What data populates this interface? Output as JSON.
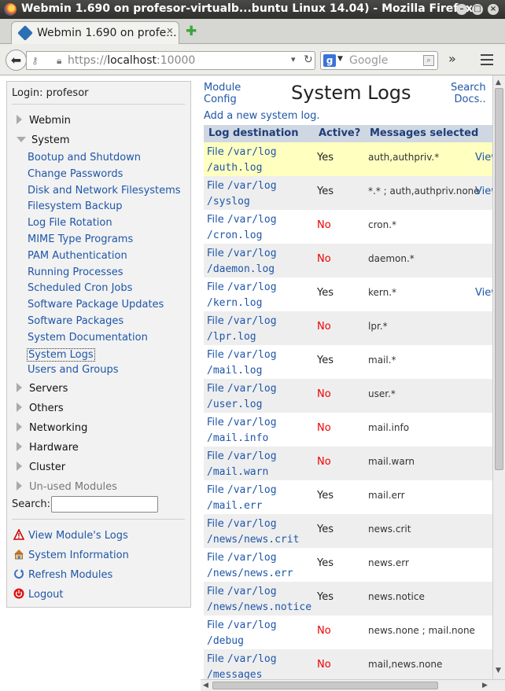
{
  "window": {
    "title": "Webmin 1.690 on profesor-virtualb...buntu Linux 14.04) - Mozilla Firefox"
  },
  "tab": {
    "label": "Webmin 1.690 on profe..."
  },
  "nav": {
    "url_prefix": "https://",
    "url_host": "localhost",
    "url_port": ":10000",
    "search_placeholder": "Google"
  },
  "left": {
    "login": "Login: profesor",
    "categories": {
      "webmin": "Webmin",
      "system": "System",
      "servers": "Servers",
      "others": "Others",
      "networking": "Networking",
      "hardware": "Hardware",
      "cluster": "Cluster",
      "unused": "Un-used Modules"
    },
    "modules": [
      "Bootup and Shutdown",
      "Change Passwords",
      "Disk and Network Filesystems",
      "Filesystem Backup",
      "Log File Rotation",
      "MIME Type Programs",
      "PAM Authentication",
      "Running Processes",
      "Scheduled Cron Jobs",
      "Software Package Updates",
      "Software Packages",
      "System Documentation",
      "System Logs",
      "Users and Groups"
    ],
    "search_label": "Search:",
    "actions": {
      "view_logs": "View Module's Logs",
      "sysinfo": "System Information",
      "refresh": "Refresh Modules",
      "logout": "Logout"
    }
  },
  "main": {
    "module_config_1": "Module",
    "module_config_2": "Config",
    "title": "System Logs",
    "search_docs_1": "Search",
    "search_docs_2": "Docs..",
    "add_log": "Add a new system log.",
    "columns": [
      "Log destination",
      "Active?",
      "Messages selected"
    ],
    "rows": [
      {
        "file": "File",
        "path1": "/var/log",
        "path2": "/auth.log",
        "active": "Yes",
        "msgs": "auth,authpriv.*",
        "view": "View",
        "highlight": true
      },
      {
        "file": "File",
        "path1": "/var/log",
        "path2": "/syslog",
        "active": "Yes",
        "msgs": "*.* ; auth,authpriv.none",
        "view": "View"
      },
      {
        "file": "File",
        "path1": "/var/log",
        "path2": "/cron.log",
        "active": "No",
        "msgs": "cron.*",
        "view": ""
      },
      {
        "file": "File",
        "path1": "/var/log",
        "path2": "/daemon.log",
        "active": "No",
        "msgs": "daemon.*",
        "view": ""
      },
      {
        "file": "File",
        "path1": "/var/log",
        "path2": "/kern.log",
        "active": "Yes",
        "msgs": "kern.*",
        "view": "View"
      },
      {
        "file": "File",
        "path1": "/var/log",
        "path2": "/lpr.log",
        "active": "No",
        "msgs": "lpr.*",
        "view": ""
      },
      {
        "file": "File",
        "path1": "/var/log",
        "path2": "/mail.log",
        "active": "Yes",
        "msgs": "mail.*",
        "view": ""
      },
      {
        "file": "File",
        "path1": "/var/log",
        "path2": "/user.log",
        "active": "No",
        "msgs": "user.*",
        "view": ""
      },
      {
        "file": "File",
        "path1": "/var/log",
        "path2": "/mail.info",
        "active": "No",
        "msgs": "mail.info",
        "view": ""
      },
      {
        "file": "File",
        "path1": "/var/log",
        "path2": "/mail.warn",
        "active": "No",
        "msgs": "mail.warn",
        "view": ""
      },
      {
        "file": "File",
        "path1": "/var/log",
        "path2": "/mail.err",
        "active": "Yes",
        "msgs": "mail.err",
        "view": ""
      },
      {
        "file": "File",
        "path1": "/var/log",
        "path2": "/news/news.crit",
        "active": "Yes",
        "msgs": "news.crit",
        "view": ""
      },
      {
        "file": "File",
        "path1": "/var/log",
        "path2": "/news/news.err",
        "active": "Yes",
        "msgs": "news.err",
        "view": ""
      },
      {
        "file": "File",
        "path1": "/var/log",
        "path2": "/news/news.notice",
        "active": "Yes",
        "msgs": "news.notice",
        "view": ""
      },
      {
        "file": "File",
        "path1": "/var/log",
        "path2": "/debug",
        "active": "No",
        "msgs": "news.none ; mail.none",
        "view": ""
      },
      {
        "file": "File",
        "path1": "/var/log",
        "path2": "/messages",
        "active": "No",
        "msgs": "mail,news.none",
        "view": ""
      }
    ]
  },
  "colors": {
    "link": "#1f56a8",
    "inactive": "#e00000",
    "highlight_row": "#ffffc0",
    "row_alt": "#eeeeee",
    "header_bg": "#cfd7e2"
  }
}
